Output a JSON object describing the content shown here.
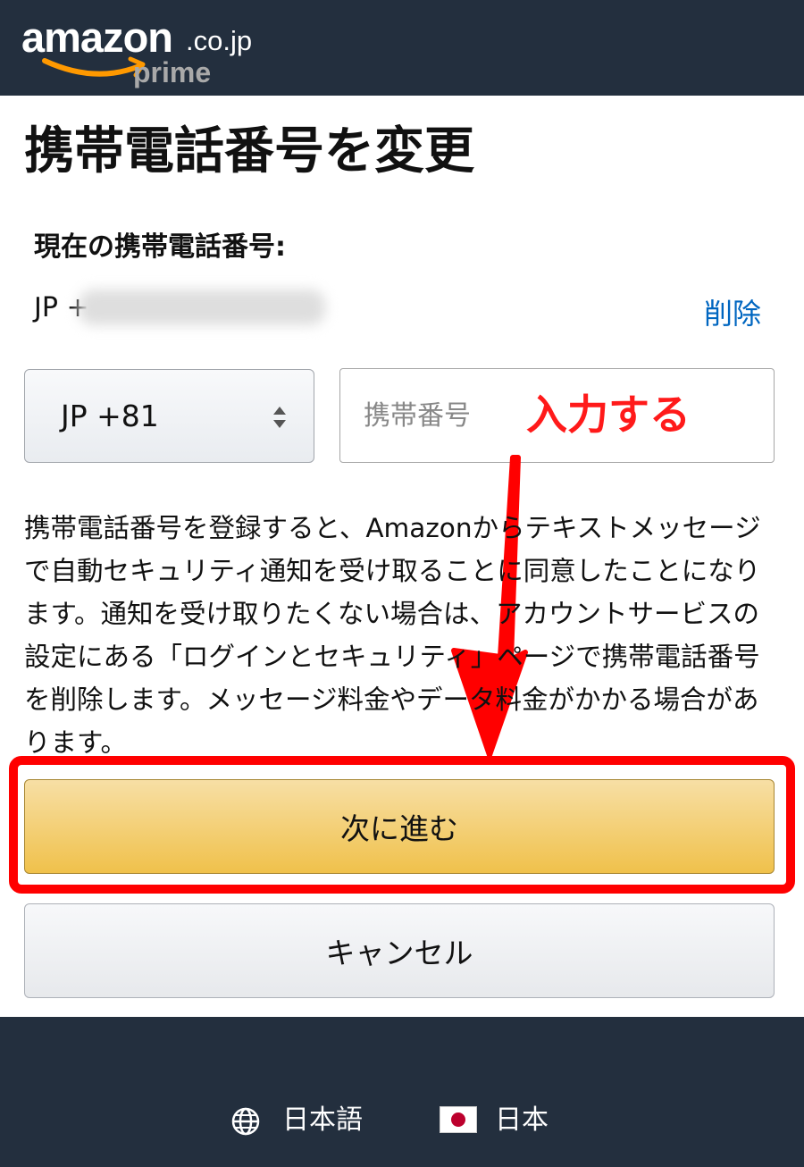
{
  "header": {
    "logo_word": "amazon",
    "logo_domain": ".co.jp",
    "logo_tagline": "prime"
  },
  "page": {
    "title": "携帯電話番号を変更",
    "current_label": "現在の携帯電話番号:",
    "current_value_prefix": "JP +",
    "delete_link": "削除"
  },
  "form": {
    "country_code": "JP +81",
    "phone_placeholder": "携帯番号",
    "phone_value": ""
  },
  "annotation": {
    "label": "入力する",
    "color": "#ff1a1a"
  },
  "notice": "携帯電話番号を登録すると、Amazonからテキストメッセージで自動セキュリティ通知を受け取ることに同意したことになります。通知を受け取りたくない場合は、アカウントサービスの設定にある「ログインとセキュリティ」ページで携帯電話番号を削除します。メッセージ料金やデータ料金がかかる場合があります。",
  "buttons": {
    "continue": "次に進む",
    "cancel": "キャンセル"
  },
  "footer": {
    "language_icon": "globe-icon",
    "language": "日本語",
    "country_icon": "japan-flag-icon",
    "country": "日本"
  },
  "colors": {
    "header_bg": "#232f3e",
    "link": "#0066c0",
    "primary_button": "#f0c14b",
    "highlight": "#ff0000"
  }
}
